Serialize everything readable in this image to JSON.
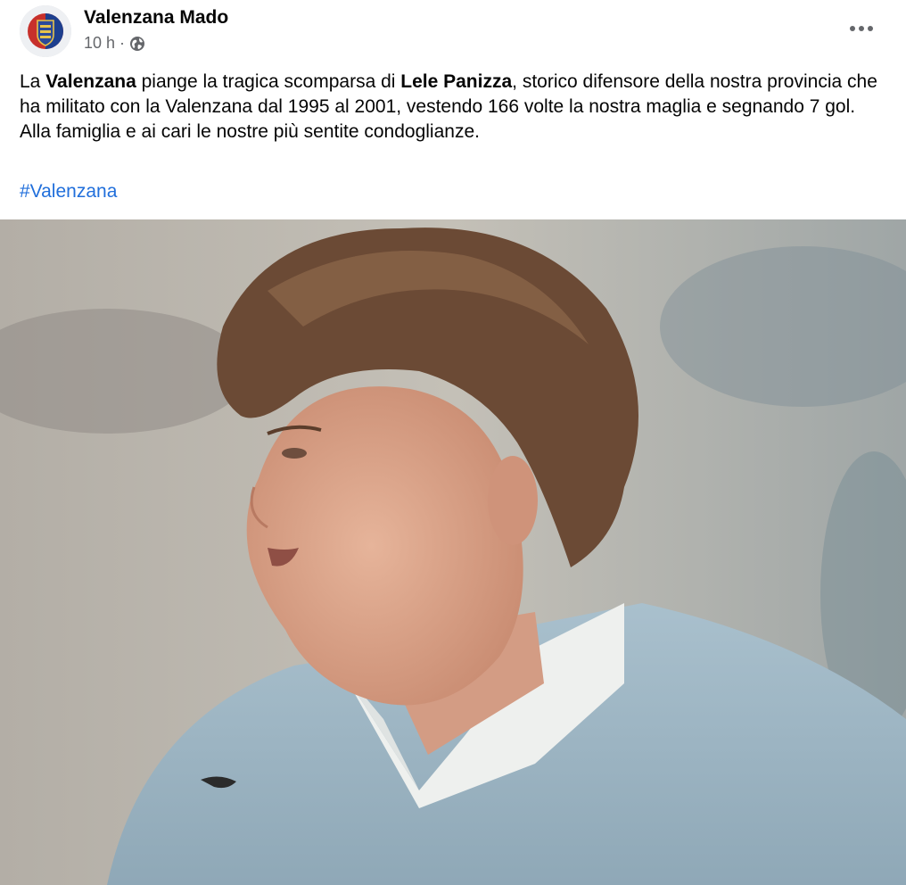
{
  "post": {
    "author": "Valenzana Mado",
    "time": "10 h",
    "separator": "·",
    "privacy_icon": "globe-icon",
    "more_icon": "more-horizontal-icon",
    "avatar_icon": "valenzana-crest-logo",
    "text": {
      "p1_part1": "La ",
      "p1_bold1": "Valenzana",
      "p1_part2": " piange la tragica scomparsa di ",
      "p1_bold2": "Lele Panizza",
      "p1_part3": ", storico difensore della nostra provincia che ha militato con la Valenzana dal 1995 al 2001, vestendo 166 volte la nostra maglia e segnando 7 gol.",
      "p2": "Alla famiglia e ai cari le nostre più sentite condoglianze."
    },
    "hashtag": "#Valenzana",
    "colors": {
      "text": "#050505",
      "secondary": "#65676b",
      "link": "#216fdb"
    }
  }
}
